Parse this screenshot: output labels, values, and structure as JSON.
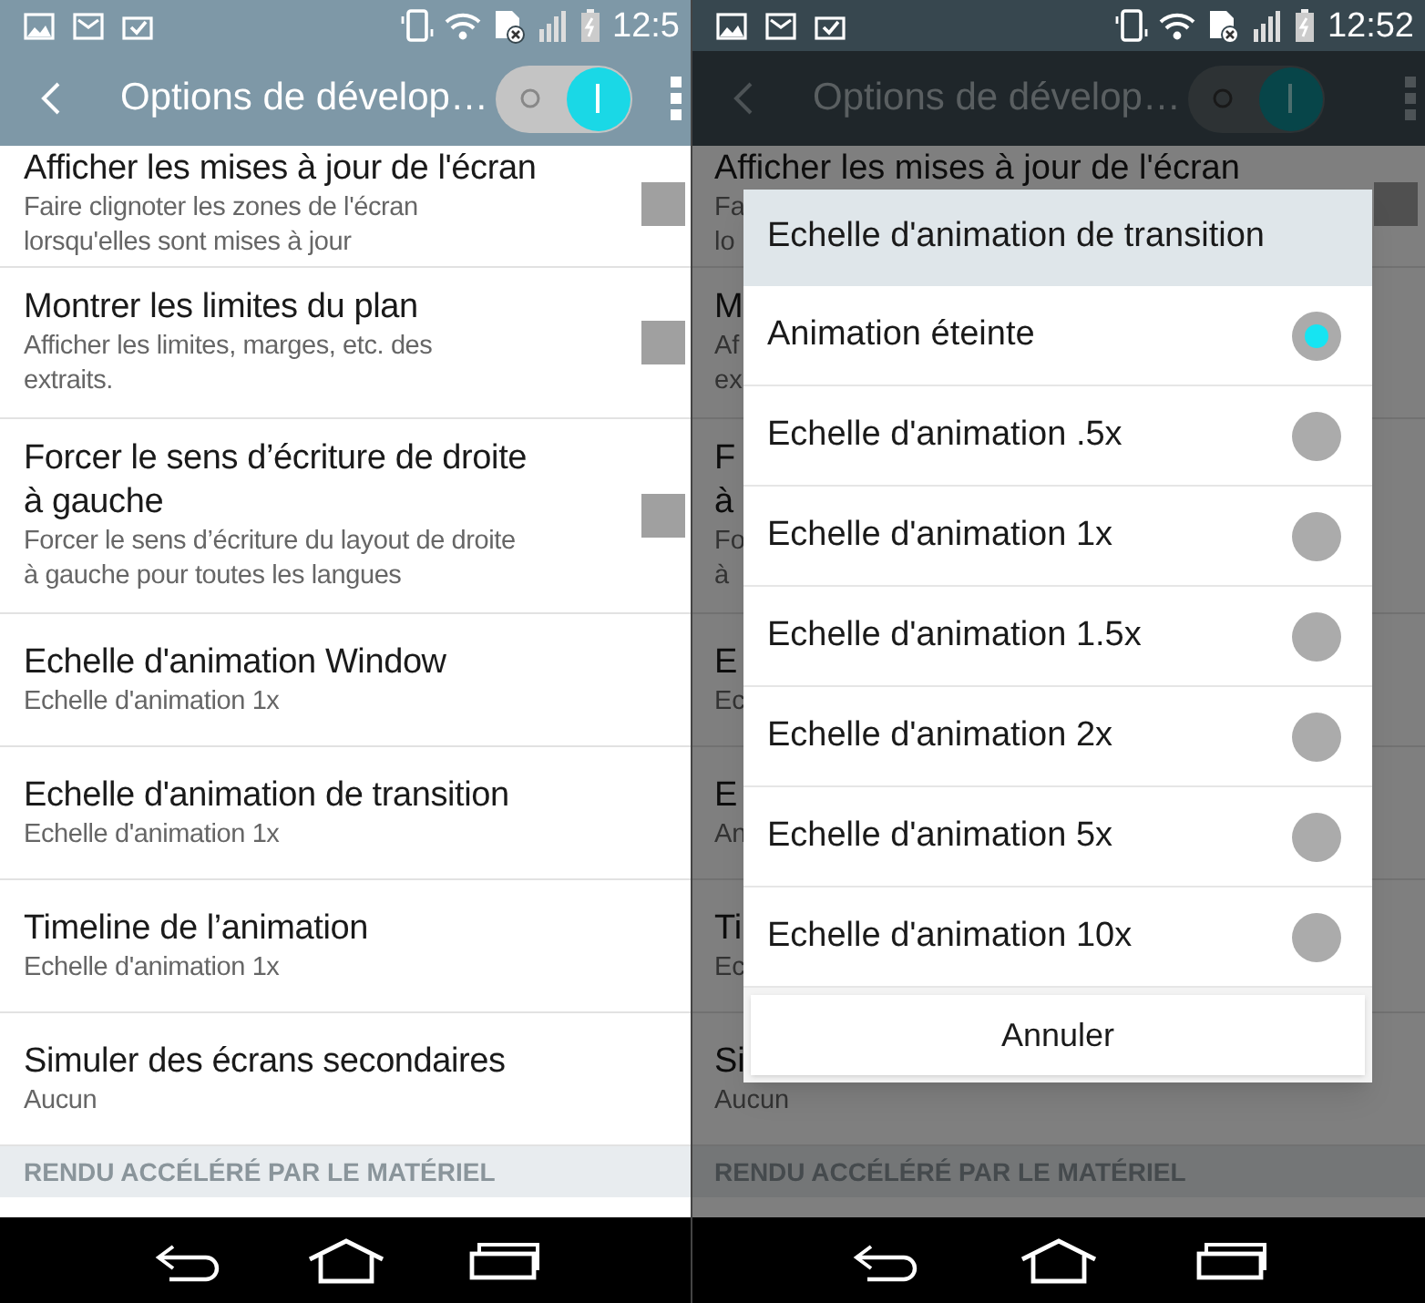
{
  "screens": [
    {
      "status_bar": {
        "time": "12:5"
      },
      "app_bar": {
        "title": "Options de dévelop…",
        "switch_on": true
      },
      "settings": [
        {
          "title": "Afficher les mises à jour de l'écran",
          "subtitle": "Faire clignoter les zones de l'écran lorsqu'elles sont mises à jour",
          "checked": false
        },
        {
          "title": "Montrer les limites du plan",
          "subtitle": "Afficher les limites, marges, etc. des extraits.",
          "checked": false
        },
        {
          "title": "Forcer le sens d’écriture de droite à gauche",
          "subtitle": "Forcer le sens d’écriture du layout de droite à gauche pour toutes les langues",
          "checked": false
        },
        {
          "title": "Echelle d'animation Window",
          "subtitle": "Echelle d'animation 1x"
        },
        {
          "title": "Echelle d'animation de transition",
          "subtitle": "Echelle d'animation 1x"
        },
        {
          "title": "Timeline de l’animation",
          "subtitle": "Echelle d'animation 1x"
        },
        {
          "title": "Simuler des écrans secondaires",
          "subtitle": "Aucun"
        }
      ],
      "section_header": "RENDU ACCÉLÉRÉ PAR LE MATÉRIEL"
    },
    {
      "status_bar": {
        "time": "12:52"
      },
      "app_bar": {
        "title": "Options de dévelop…",
        "switch_on": true
      },
      "settings": [
        {
          "title_lines": [
            "Afficher les mises à jour de l'écran"
          ],
          "subtitle_lines": [
            "Fa",
            "lo"
          ],
          "checked": false
        },
        {
          "title_lines": [
            "M"
          ],
          "subtitle_lines": [
            "Af",
            "ex"
          ]
        },
        {
          "title_lines": [
            "F",
            "à"
          ],
          "subtitle_lines": [
            "Fo",
            "à"
          ]
        },
        {
          "title_lines": [
            "E"
          ],
          "subtitle_lines": [
            "Ec"
          ]
        },
        {
          "title_lines": [
            "E"
          ],
          "subtitle_lines": [
            "An"
          ]
        },
        {
          "title_lines": [
            "Ti"
          ],
          "subtitle_lines": [
            "Ec"
          ]
        },
        {
          "title_lines": [
            "Si"
          ],
          "subtitle_lines": [
            "Aucun"
          ]
        }
      ],
      "section_header": "RENDU ACCÉLÉRÉ PAR LE MATÉRIEL",
      "dialog": {
        "title": "Echelle d'animation de transition",
        "options": [
          {
            "label": "Animation éteinte",
            "selected": true
          },
          {
            "label": "Echelle d'animation .5x",
            "selected": false
          },
          {
            "label": "Echelle d'animation 1x",
            "selected": false
          },
          {
            "label": "Echelle d'animation 1.5x",
            "selected": false
          },
          {
            "label": "Echelle d'animation 2x",
            "selected": false
          },
          {
            "label": "Echelle d'animation 5x",
            "selected": false
          },
          {
            "label": "Echelle d'animation 10x",
            "selected": false
          }
        ],
        "cancel_button": "Annuler"
      }
    }
  ]
}
